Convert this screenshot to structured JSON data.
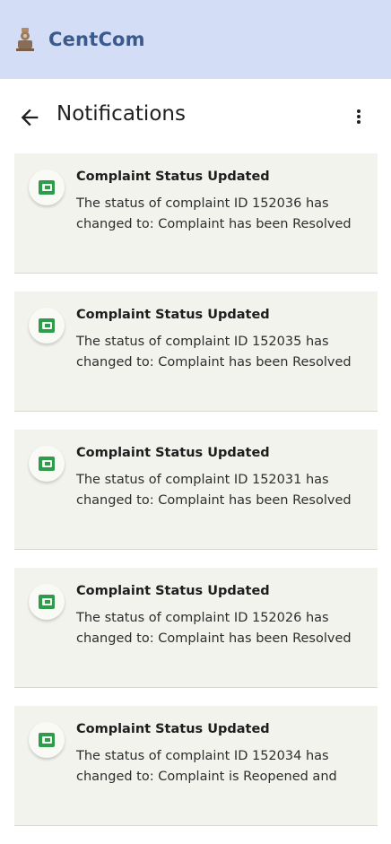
{
  "app": {
    "name": "CentCom",
    "logo_icon": "emblem-icon"
  },
  "header": {
    "title": "Notifications",
    "back_icon": "arrow-left-icon",
    "menu_icon": "more-vert-icon"
  },
  "colors": {
    "app_bar": "#d3ddf5",
    "brand_text": "#3a5a8c",
    "card_bg": "#f3f3ee",
    "icon_green": "#2e9c4a"
  },
  "notifications": [
    {
      "title": "Complaint Status Updated",
      "body": "The status of complaint ID 152036 has changed to: Complaint has been Resolved",
      "icon": "wallet-icon"
    },
    {
      "title": "Complaint Status Updated",
      "body": "The status of complaint ID 152035 has changed to: Complaint has been Resolved",
      "icon": "wallet-icon"
    },
    {
      "title": "Complaint Status Updated",
      "body": "The status of complaint ID 152031 has changed to: Complaint has been Resolved",
      "icon": "wallet-icon"
    },
    {
      "title": "Complaint Status Updated",
      "body": "The status of complaint ID 152026 has changed to: Complaint has been Resolved",
      "icon": "wallet-icon"
    },
    {
      "title": "Complaint Status Updated",
      "body": "The status of complaint ID 152034 has changed to: Complaint is Reopened and",
      "icon": "wallet-icon"
    }
  ]
}
